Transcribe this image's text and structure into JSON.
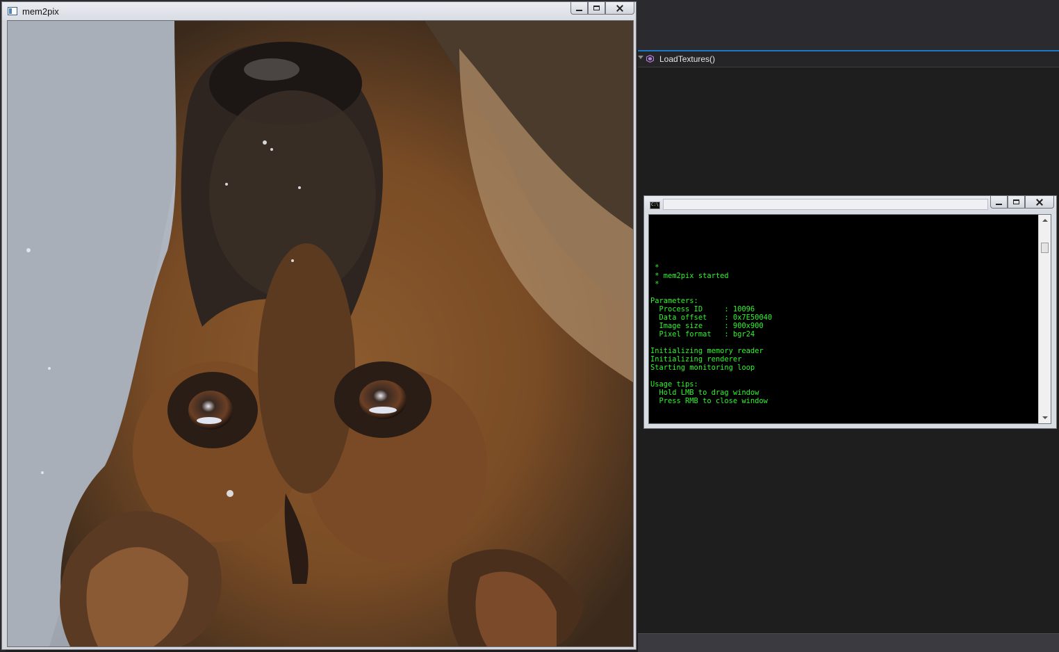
{
  "ide": {
    "nav_function": "LoadTextures()"
  },
  "mem2pix_window": {
    "title": "mem2pix",
    "image_description": "upside-down photo of a German shepherd dog's face",
    "icon": "app-window-icon"
  },
  "console_window": {
    "icon": "cmd-icon",
    "lines": [
      " *",
      " * mem2pix started",
      " *",
      "",
      "Parameters:",
      "  Process ID     : 10096",
      "  Data offset    : 0x7E50040",
      "  Image size     : 900x900",
      "  Pixel format   : bgr24",
      "",
      "Initializing memory reader",
      "Initializing renderer",
      "Starting monitoring loop",
      "",
      "Usage tips:",
      "  Hold LMB to drag window",
      "  Press RMB to close window"
    ]
  },
  "colors": {
    "console_text": "#2ff22f",
    "ide_accent": "#1e79c4"
  }
}
